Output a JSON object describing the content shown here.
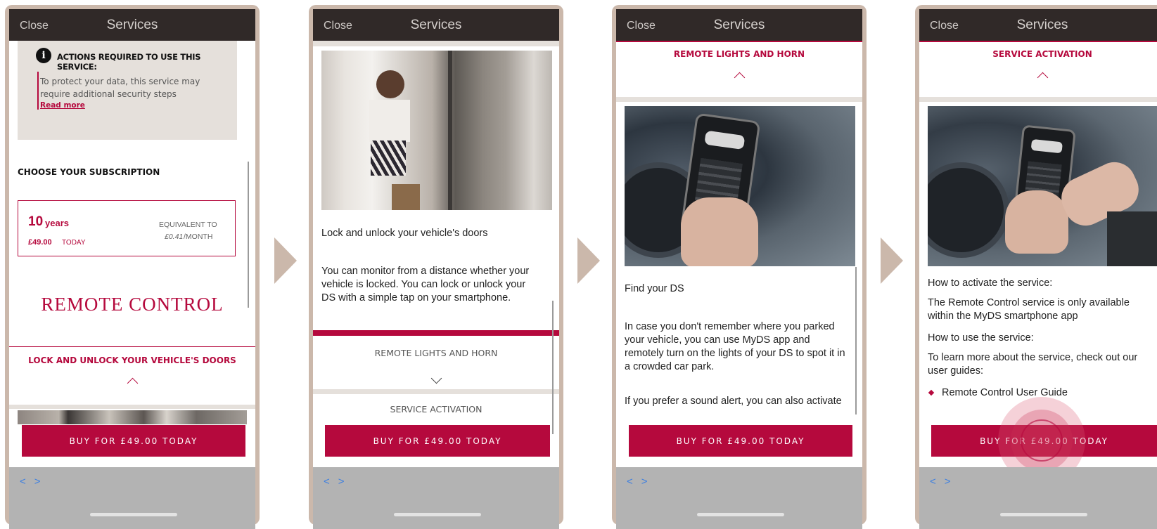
{
  "common": {
    "close_label": "Close",
    "title": "Services",
    "buy_label": "BUY FOR £49.00 TODAY",
    "nav_prev": "<",
    "nav_next": ">"
  },
  "screen1": {
    "actions_title": "ACTIONS REQUIRED TO USE THIS SERVICE:",
    "actions_text": "To protect your data, this service may require additional security steps",
    "read_more": "Read more",
    "choose_title": "CHOOSE YOUR SUBSCRIPTION",
    "plan_years_number": "10",
    "plan_years_unit": "years",
    "plan_price_amount": "£49.00",
    "plan_price_suffix": "TODAY",
    "plan_equivalent": "EQUIVALENT TO",
    "plan_monthly_amount": "£0.41",
    "plan_monthly_suffix": "/MONTH",
    "remote_title": "REMOTE CONTROL",
    "feature_title": "LOCK AND UNLOCK YOUR VEHICLE'S DOORS"
  },
  "screen2": {
    "feature_title": "Lock and unlock your vehicle's doors",
    "feature_text": "You can monitor from a distance whether your vehicle is locked. You can lock or unlock your DS with a simple tap on your smartphone.",
    "section1": "REMOTE LIGHTS AND HORN",
    "section2": "SERVICE ACTIVATION"
  },
  "screen3": {
    "section_title": "REMOTE LIGHTS AND HORN",
    "feature_title": "Find your DS",
    "feature_text": "In case you don't remember where you parked your vehicle,  you can use MyDS app and remotely turn on the lights of your DS to spot it in a crowded car park.",
    "feature_text2": "If you prefer a sound alert, you can also activate"
  },
  "screen4": {
    "section_title": "SERVICE ACTIVATION",
    "how_activate": "How to activate the service:",
    "activate_text": "The Remote Control service is only available within the MyDS smartphone app",
    "how_use": "How to use the service:",
    "use_text": "To learn more about the service, check out our user guides:",
    "guide_link": "Remote Control User Guide"
  },
  "colors": {
    "accent": "#b5093d",
    "topbar": "#302928",
    "frame": "#cbb8ab",
    "notice_bg": "#e5e0db",
    "bottombar": "#b3b3b3",
    "link_blue": "#3d7fe0"
  }
}
